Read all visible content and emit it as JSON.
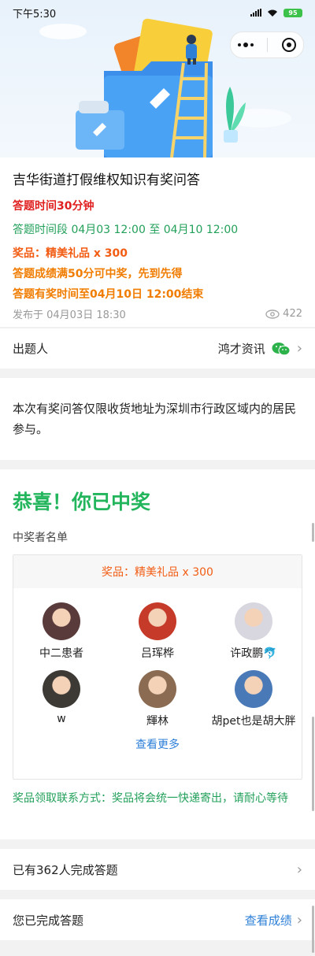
{
  "status_bar": {
    "time": "下午5:30",
    "battery": "95"
  },
  "quiz": {
    "title": "吉华街道打假维权知识有奖问答",
    "time_limit": "答题时间30分钟",
    "period": "答题时间段 04月03 12:00 至 04月10 12:00",
    "prize": "奖品：精美礼品 x 300",
    "rule": "答题成绩满50分可中奖，先到先得",
    "deadline": "答题有奖时间至04月10日 12:00结束",
    "published": "发布于 04月03日 18:30",
    "views": "422"
  },
  "author": {
    "label": "出题人",
    "name": "鸿才资讯"
  },
  "notice": "本次有奖问答仅限收货地址为深圳市行政区域内的居民参与。",
  "winners": {
    "congrats": "恭喜！你已中奖",
    "list_title": "中奖者名单",
    "prize_header": "奖品：精美礼品 x 300",
    "people": [
      {
        "name": "中二患者",
        "color": "#5a3b3b"
      },
      {
        "name": "吕珲桦",
        "color": "#c63a2a"
      },
      {
        "name": "许政鹏🐬",
        "color": "#d8d6de"
      },
      {
        "name": "w",
        "color": "#3d3a36"
      },
      {
        "name": "輝林",
        "color": "#8b6c52"
      },
      {
        "name": "胡pet也是胡大胖",
        "color": "#4a79b8"
      }
    ],
    "see_more": "查看更多",
    "contact": "奖品领取联系方式：奖品将会统一快递寄出，请耐心等待"
  },
  "completed_row": {
    "label": "已有362人完成答题"
  },
  "my_result_row": {
    "label": "您已完成答题",
    "link": "查看成绩"
  },
  "colors": {
    "accent_green": "#22b55c",
    "link_blue": "#2d7fd8",
    "prize_orange": "#f25c13"
  }
}
